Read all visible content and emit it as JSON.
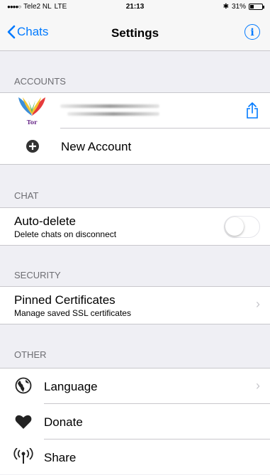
{
  "status": {
    "carrier": "Tele2 NL",
    "network": "LTE",
    "time": "21:13",
    "battery_pct_text": "31%",
    "battery_level": 0.31
  },
  "nav": {
    "back_label": "Chats",
    "title": "Settings",
    "info_icon": "info-icon"
  },
  "sections": {
    "accounts": {
      "header": "ACCOUNTS",
      "account_logo_text": "Tor",
      "new_account_label": "New Account"
    },
    "chat": {
      "header": "CHAT",
      "auto_delete_title": "Auto-delete",
      "auto_delete_subtitle": "Delete chats on disconnect",
      "auto_delete_on": false
    },
    "security": {
      "header": "SECURITY",
      "pinned_title": "Pinned Certificates",
      "pinned_subtitle": "Manage saved SSL certificates"
    },
    "other": {
      "header": "OTHER",
      "language_label": "Language",
      "donate_label": "Donate",
      "share_label": "Share"
    }
  },
  "colors": {
    "accent": "#007aff",
    "background": "#efeff4",
    "separator": "#c8c7cc"
  }
}
